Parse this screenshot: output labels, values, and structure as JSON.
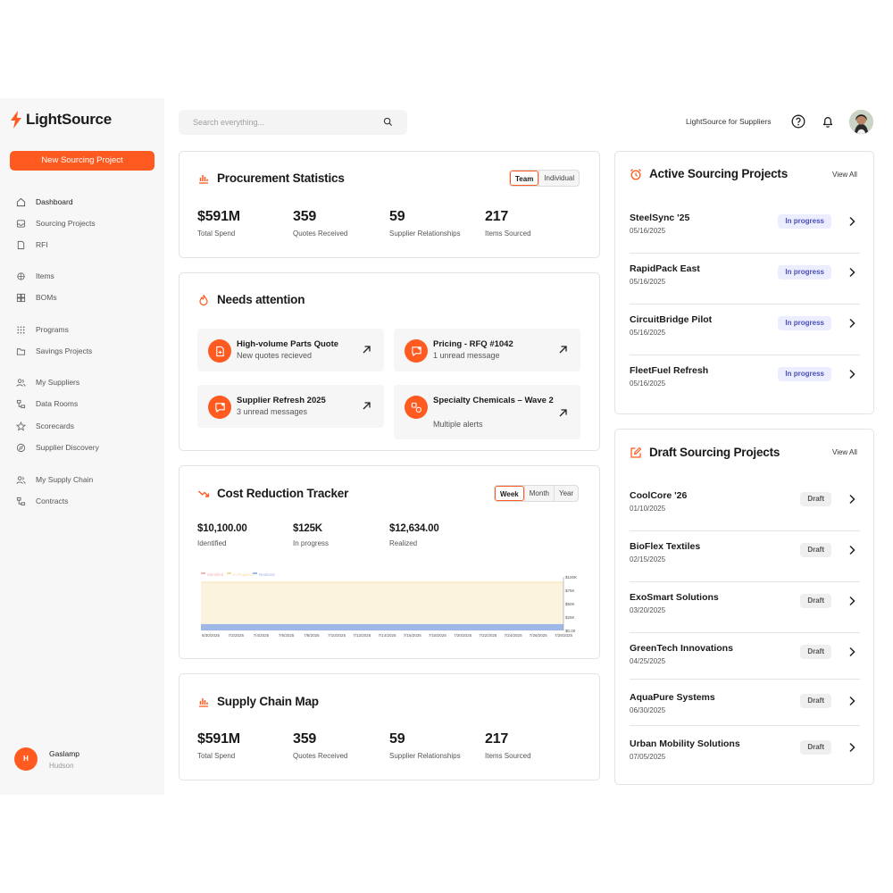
{
  "brand": {
    "name": "LightSource",
    "accent": "#ff5a1f"
  },
  "sidebar": {
    "new_button": "New Sourcing Project",
    "items": [
      {
        "label": "Dashboard",
        "icon": "home-icon"
      },
      {
        "label": "Sourcing Projects",
        "icon": "inbox-icon"
      },
      {
        "label": "RFI",
        "icon": "document-icon"
      },
      {
        "label": "Items",
        "icon": "items-icon"
      },
      {
        "label": "BOMs",
        "icon": "grid-icon"
      },
      {
        "label": "Programs",
        "icon": "dots-grid-icon"
      },
      {
        "label": "Savings Projects",
        "icon": "folder-icon"
      },
      {
        "label": "My Suppliers",
        "icon": "users-icon"
      },
      {
        "label": "Data Rooms",
        "icon": "hierarchy-icon"
      },
      {
        "label": "Scorecards",
        "icon": "star-icon"
      },
      {
        "label": "Supplier Discovery",
        "icon": "discovery-icon"
      },
      {
        "label": "My Supply Chain",
        "icon": "users-icon"
      },
      {
        "label": "Contracts",
        "icon": "hierarchy-icon"
      }
    ],
    "user": {
      "initial": "H",
      "name": "Gaslamp",
      "sub": "Hudson"
    }
  },
  "topbar": {
    "search_placeholder": "Search everything...",
    "for_suppliers": "LightSource for Suppliers"
  },
  "procurement": {
    "title": "Procurement Statistics",
    "toggle": [
      "Team",
      "Individual"
    ],
    "selected": "Team",
    "stats": [
      {
        "value": "$591M",
        "label": "Total Spend"
      },
      {
        "value": "359",
        "label": "Quotes Received"
      },
      {
        "value": "59",
        "label": "Supplier Relationships"
      },
      {
        "value": "217",
        "label": "Items Sourced"
      }
    ]
  },
  "attention": {
    "title": "Needs attention",
    "items": [
      {
        "title": "High-volume Parts Quote",
        "sub": "New quotes recieved",
        "icon": "quote-icon"
      },
      {
        "title": "Pricing  - RFQ #1042",
        "sub": "1 unread message",
        "icon": "message-icon"
      },
      {
        "title": "Supplier Refresh 2025",
        "sub": "3 unread messages",
        "icon": "message-icon"
      },
      {
        "title": "Specialty Chemicals – Wave 2",
        "sub": "Multiple alerts",
        "icon": "alerts-icon"
      }
    ]
  },
  "cost": {
    "title": "Cost Reduction Tracker",
    "toggle": [
      "Week",
      "Month",
      "Year"
    ],
    "selected": "Week",
    "stats": [
      {
        "value": "$10,100.00",
        "label": "Identified"
      },
      {
        "value": "$125K",
        "label": "In progress"
      },
      {
        "value": "$12,634.00",
        "label": "Realized"
      }
    ]
  },
  "chart_data": {
    "type": "area",
    "legend": [
      "Identified",
      "In Progress",
      "Realized"
    ],
    "legend_placement": "top-left",
    "colors": {
      "Identified": "#f6b3b3",
      "In Progress": "#f5d9a0",
      "Realized": "#9fb7e6"
    },
    "x": [
      "6/30/2025",
      "7/2/2025",
      "7/4/2025",
      "7/6/2025",
      "7/8/2025",
      "7/10/2025",
      "7/12/2025",
      "7/14/2025",
      "7/16/2025",
      "7/18/2025",
      "7/20/2025",
      "7/22/2025",
      "7/24/2025",
      "7/26/2025",
      "7/28/2025"
    ],
    "y_ticks": [
      "$100K",
      "$75K",
      "$50K",
      "$25K",
      "$0.00"
    ],
    "ylim": [
      0,
      100000
    ],
    "series": [
      {
        "name": "In Progress",
        "values": [
          125000,
          125000,
          125000,
          125000,
          125000,
          125000,
          125000,
          125000,
          125000,
          125000,
          125000,
          125000,
          125000,
          125000,
          125000
        ]
      },
      {
        "name": "Realized",
        "values": [
          12634,
          12634,
          12634,
          12634,
          12634,
          12634,
          12634,
          12634,
          12634,
          12634,
          12634,
          12634,
          12634,
          12634,
          12634
        ]
      }
    ]
  },
  "supply_chain": {
    "title": "Supply Chain Map",
    "stats": [
      {
        "value": "$591M",
        "label": "Total Spend"
      },
      {
        "value": "359",
        "label": "Quotes Received"
      },
      {
        "value": "59",
        "label": "Supplier Relationships"
      },
      {
        "value": "217",
        "label": "Items Sourced"
      }
    ]
  },
  "active": {
    "title": "Active Sourcing Projects",
    "view_all": "View All",
    "items": [
      {
        "name": "SteelSync '25",
        "date": "05/16/2025",
        "status": "In progress"
      },
      {
        "name": "RapidPack East",
        "date": "05/16/2025",
        "status": "In progress"
      },
      {
        "name": "CircuitBridge Pilot",
        "date": "05/16/2025",
        "status": "In progress"
      },
      {
        "name": "FleetFuel Refresh",
        "date": "05/16/2025",
        "status": "In progress"
      }
    ]
  },
  "draft": {
    "title": "Draft Sourcing Projects",
    "view_all": "View All",
    "items": [
      {
        "name": "CoolCore '26",
        "date": "01/10/2025",
        "status": "Draft"
      },
      {
        "name": "BioFlex Textiles",
        "date": "02/15/2025",
        "status": "Draft"
      },
      {
        "name": "ExoSmart Solutions",
        "date": "03/20/2025",
        "status": "Draft"
      },
      {
        "name": "GreenTech Innovations",
        "date": "04/25/2025",
        "status": "Draft"
      },
      {
        "name": "AquaPure Systems",
        "date": "06/30/2025",
        "status": "Draft"
      },
      {
        "name": "Urban Mobility Solutions",
        "date": "07/05/2025",
        "status": "Draft"
      }
    ]
  }
}
